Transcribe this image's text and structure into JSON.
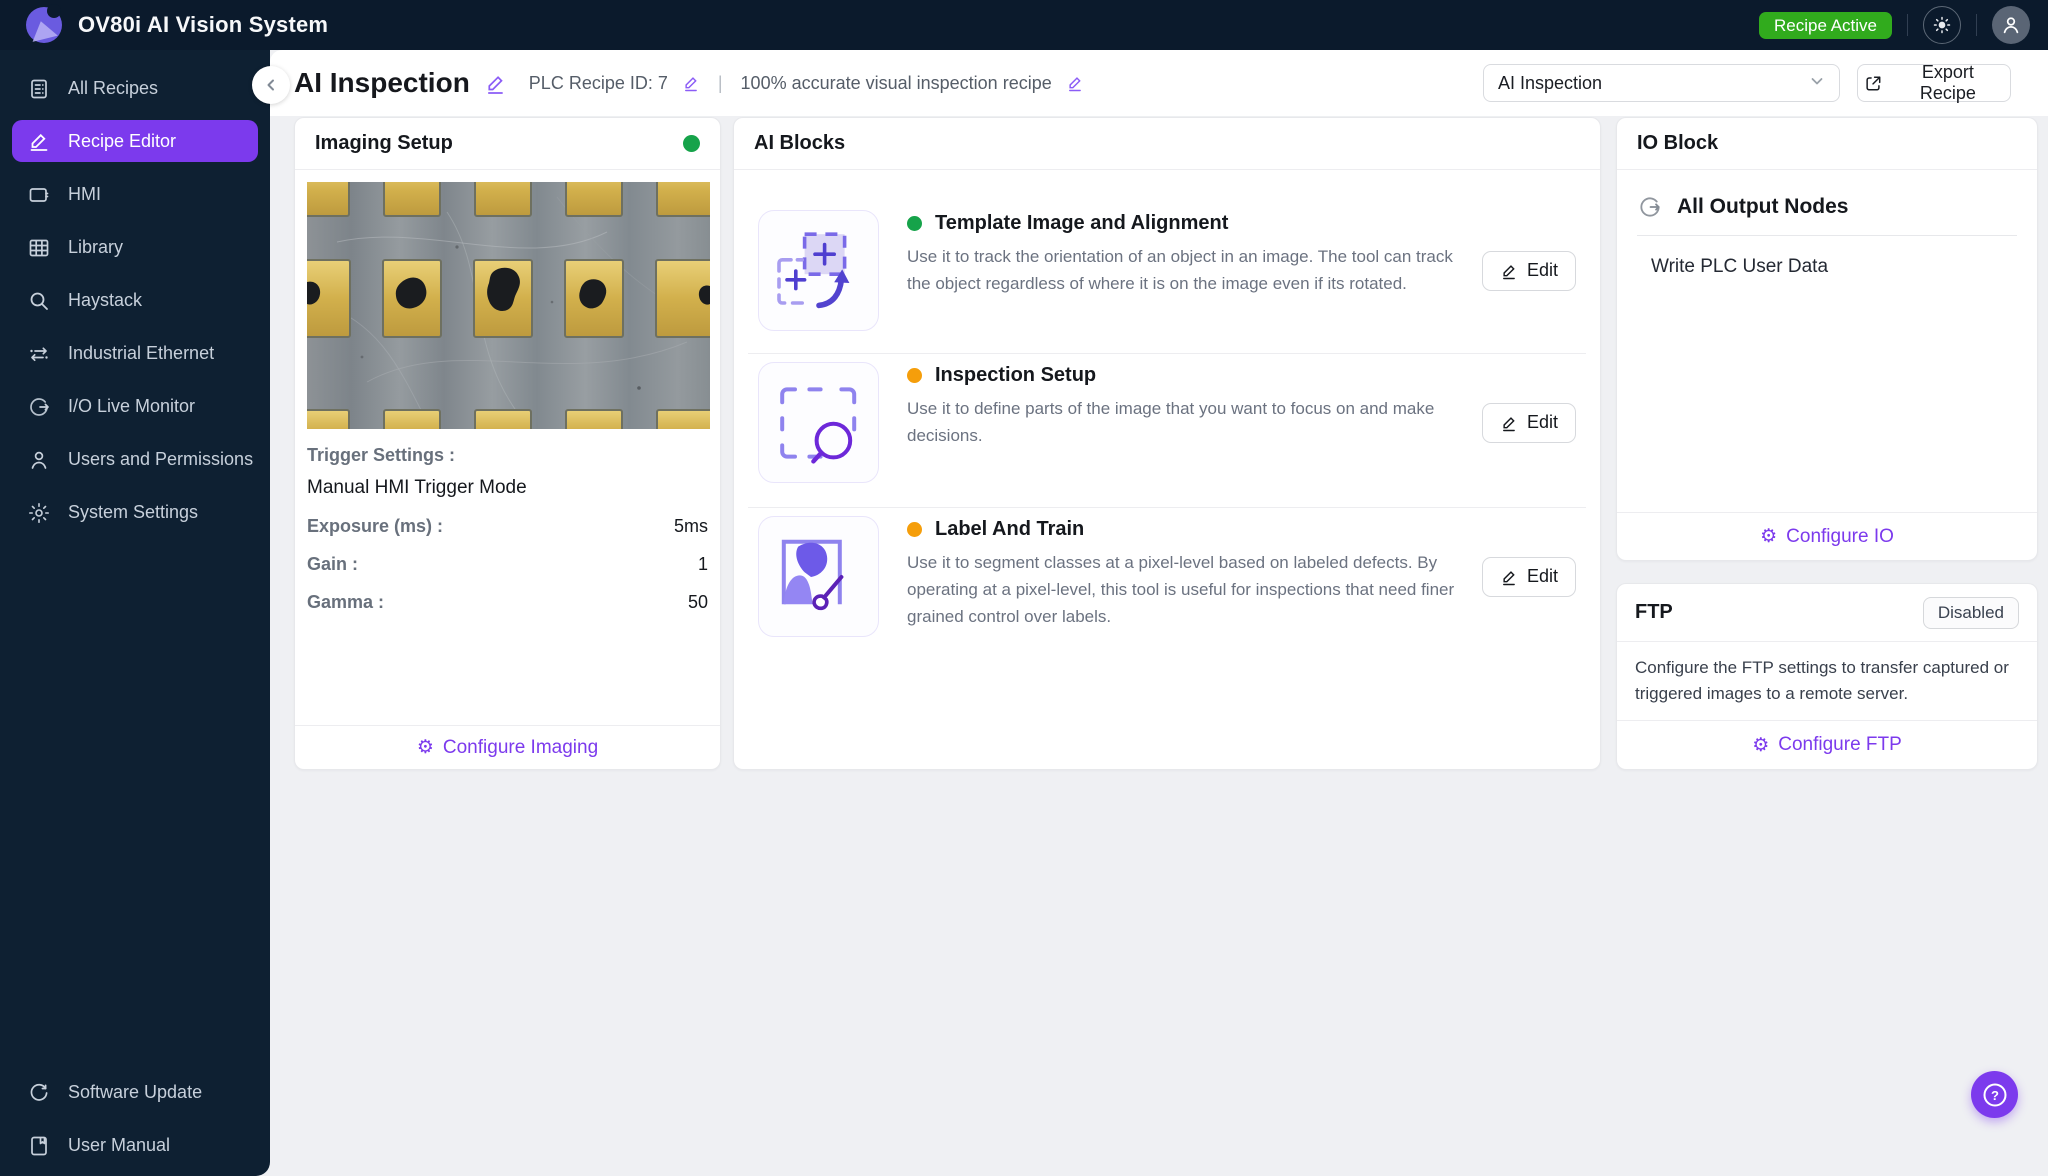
{
  "app": {
    "title": "OV80i AI Vision System",
    "status_badge": "Recipe Active",
    "logo_icon": "ov80i-logo-icon",
    "theme_icon": "sun-icon",
    "avatar_icon": "user-avatar-icon"
  },
  "sidebar": {
    "items": [
      {
        "label": "All Recipes",
        "icon": "recipes-icon",
        "active": false
      },
      {
        "label": "Recipe Editor",
        "icon": "pencil-icon",
        "active": true
      },
      {
        "label": "HMI",
        "icon": "monitor-icon",
        "active": false
      },
      {
        "label": "Library",
        "icon": "grid-icon",
        "active": false
      },
      {
        "label": "Haystack",
        "icon": "search-icon",
        "active": false
      },
      {
        "label": "Industrial Ethernet",
        "icon": "ethernet-arrows-icon",
        "active": false
      },
      {
        "label": "I/O Live Monitor",
        "icon": "io-monitor-icon",
        "active": false
      },
      {
        "label": "Users and Permissions",
        "icon": "user-icon",
        "active": false
      },
      {
        "label": "System Settings",
        "icon": "gear-icon",
        "active": false
      }
    ],
    "bottom_items": [
      {
        "label": "Software Update",
        "icon": "refresh-icon"
      },
      {
        "label": "User Manual",
        "icon": "manual-icon"
      }
    ]
  },
  "header": {
    "title": "AI Inspection",
    "plc_recipe": "PLC Recipe ID: 7",
    "divider": "|",
    "subtitle": "100% accurate visual inspection recipe",
    "recipe_dropdown_value": "AI Inspection",
    "export_button": "Export Recipe"
  },
  "imaging": {
    "title": "Imaging Setup",
    "status_color": "#16a34a",
    "trigger_label": "Trigger Settings :",
    "trigger_mode": "Manual HMI Trigger Mode",
    "settings": [
      {
        "label": "Exposure (ms) :",
        "value": "5ms"
      },
      {
        "label": "Gain :",
        "value": "1"
      },
      {
        "label": "Gamma :",
        "value": "50"
      }
    ],
    "configure_label": "Configure Imaging"
  },
  "ai_blocks": {
    "title": "AI Blocks",
    "edit_label": "Edit",
    "blocks": [
      {
        "name": "Template Image and Alignment",
        "status_color": "#16a34a",
        "icon": "template-alignment-icon",
        "description": "Use it to track the orientation of an object in an image. The tool can track the object regardless of where it is on the image even if its rotated."
      },
      {
        "name": "Inspection Setup",
        "status_color": "#f59e0b",
        "icon": "inspection-setup-icon",
        "description": "Use it to define parts of the image that you want to focus on and make decisions."
      },
      {
        "name": "Label And Train",
        "status_color": "#f59e0b",
        "icon": "label-train-icon",
        "description": "Use it to segment classes at a pixel-level based on labeled defects. By operating at a pixel-level, this tool is useful for inspections that need finer grained control over labels."
      }
    ]
  },
  "io_block": {
    "title": "IO Block",
    "group_label": "All Output Nodes",
    "group_icon": "output-nodes-icon",
    "nodes": [
      "Write PLC User Data"
    ],
    "configure_label": "Configure IO"
  },
  "ftp": {
    "title": "FTP",
    "status": "Disabled",
    "description": "Configure the FTP settings to transfer captured or triggered images to a remote server.",
    "configure_label": "Configure FTP"
  },
  "colors": {
    "accent_purple": "#7c3aed",
    "active_green": "#16a34a",
    "warning_amber": "#f59e0b",
    "badge_green": "#31ab1d"
  }
}
